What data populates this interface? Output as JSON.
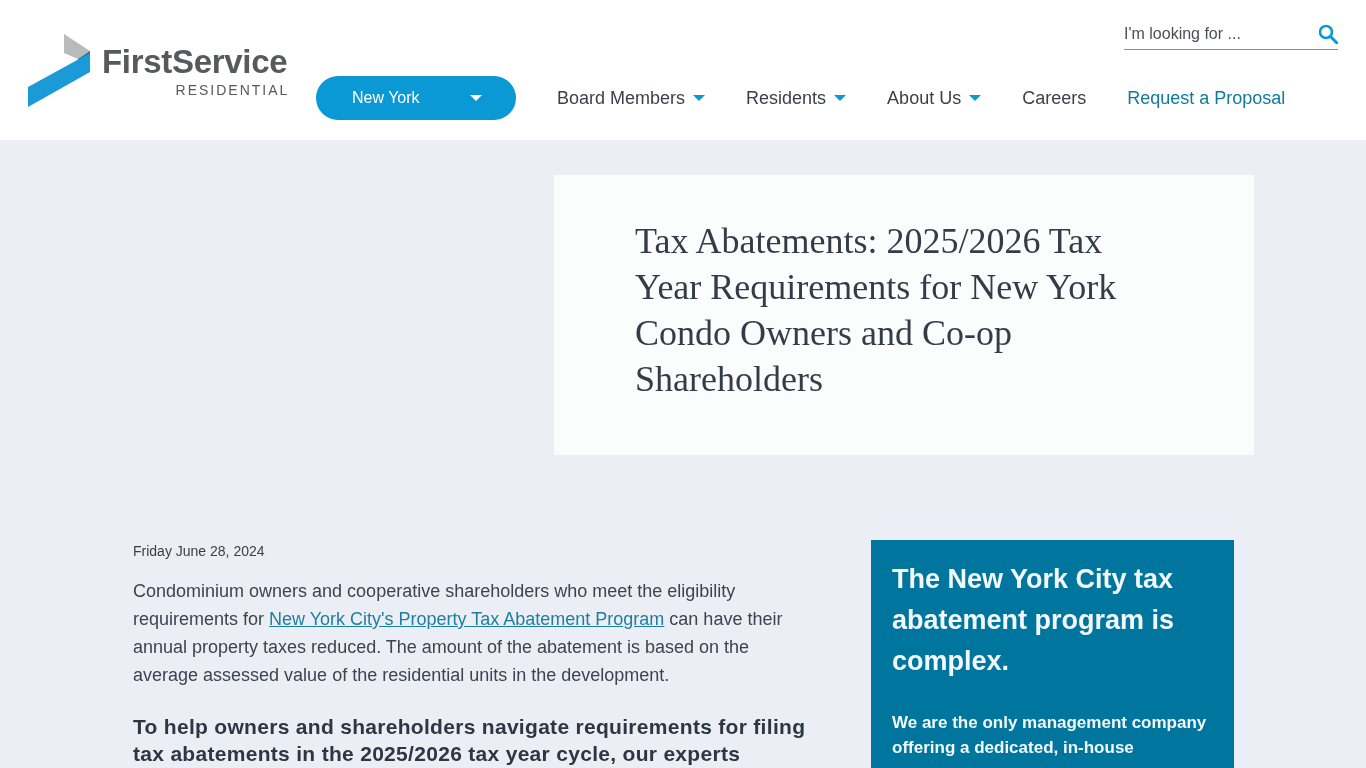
{
  "header": {
    "logo": {
      "name": "FirstService",
      "tagline": "RESIDENTIAL"
    },
    "search": {
      "placeholder": "I'm looking for ..."
    },
    "region_select": {
      "value": "New York"
    },
    "nav": [
      {
        "label": "Board Members",
        "kind": "menu"
      },
      {
        "label": "Residents",
        "kind": "menu"
      },
      {
        "label": "About Us",
        "kind": "menu"
      },
      {
        "label": "Careers",
        "kind": "link"
      },
      {
        "label": "Request a Proposal",
        "kind": "cta"
      }
    ]
  },
  "hero": {
    "title": "Tax Abatements: 2025/2026 Tax Year Requirements for New York Condo Owners and Co-op Shareholders"
  },
  "article": {
    "date": "Friday June 28, 2024",
    "paragraphs": [
      {
        "kind": "body",
        "parts": [
          {
            "kind": "text",
            "text": "Condominium owners and cooperative shareholders who meet the eligibility requirements for "
          },
          {
            "kind": "link",
            "text": "New York City's Property Tax Abatement Program"
          },
          {
            "kind": "text",
            "text": " can have their annual property taxes reduced. The amount of the abatement is based on the average assessed value of the residential units in the development."
          }
        ]
      },
      {
        "kind": "lead",
        "parts": [
          {
            "kind": "text",
            "text": "To help owners and shareholders navigate requirements for filing tax abatements in the 2025/2026 tax year cycle, our experts"
          }
        ]
      }
    ]
  },
  "sidebar": {
    "heading": "The New York City tax abatement program is complex.",
    "text": "We are the only management company offering a dedicated, in-house"
  }
}
